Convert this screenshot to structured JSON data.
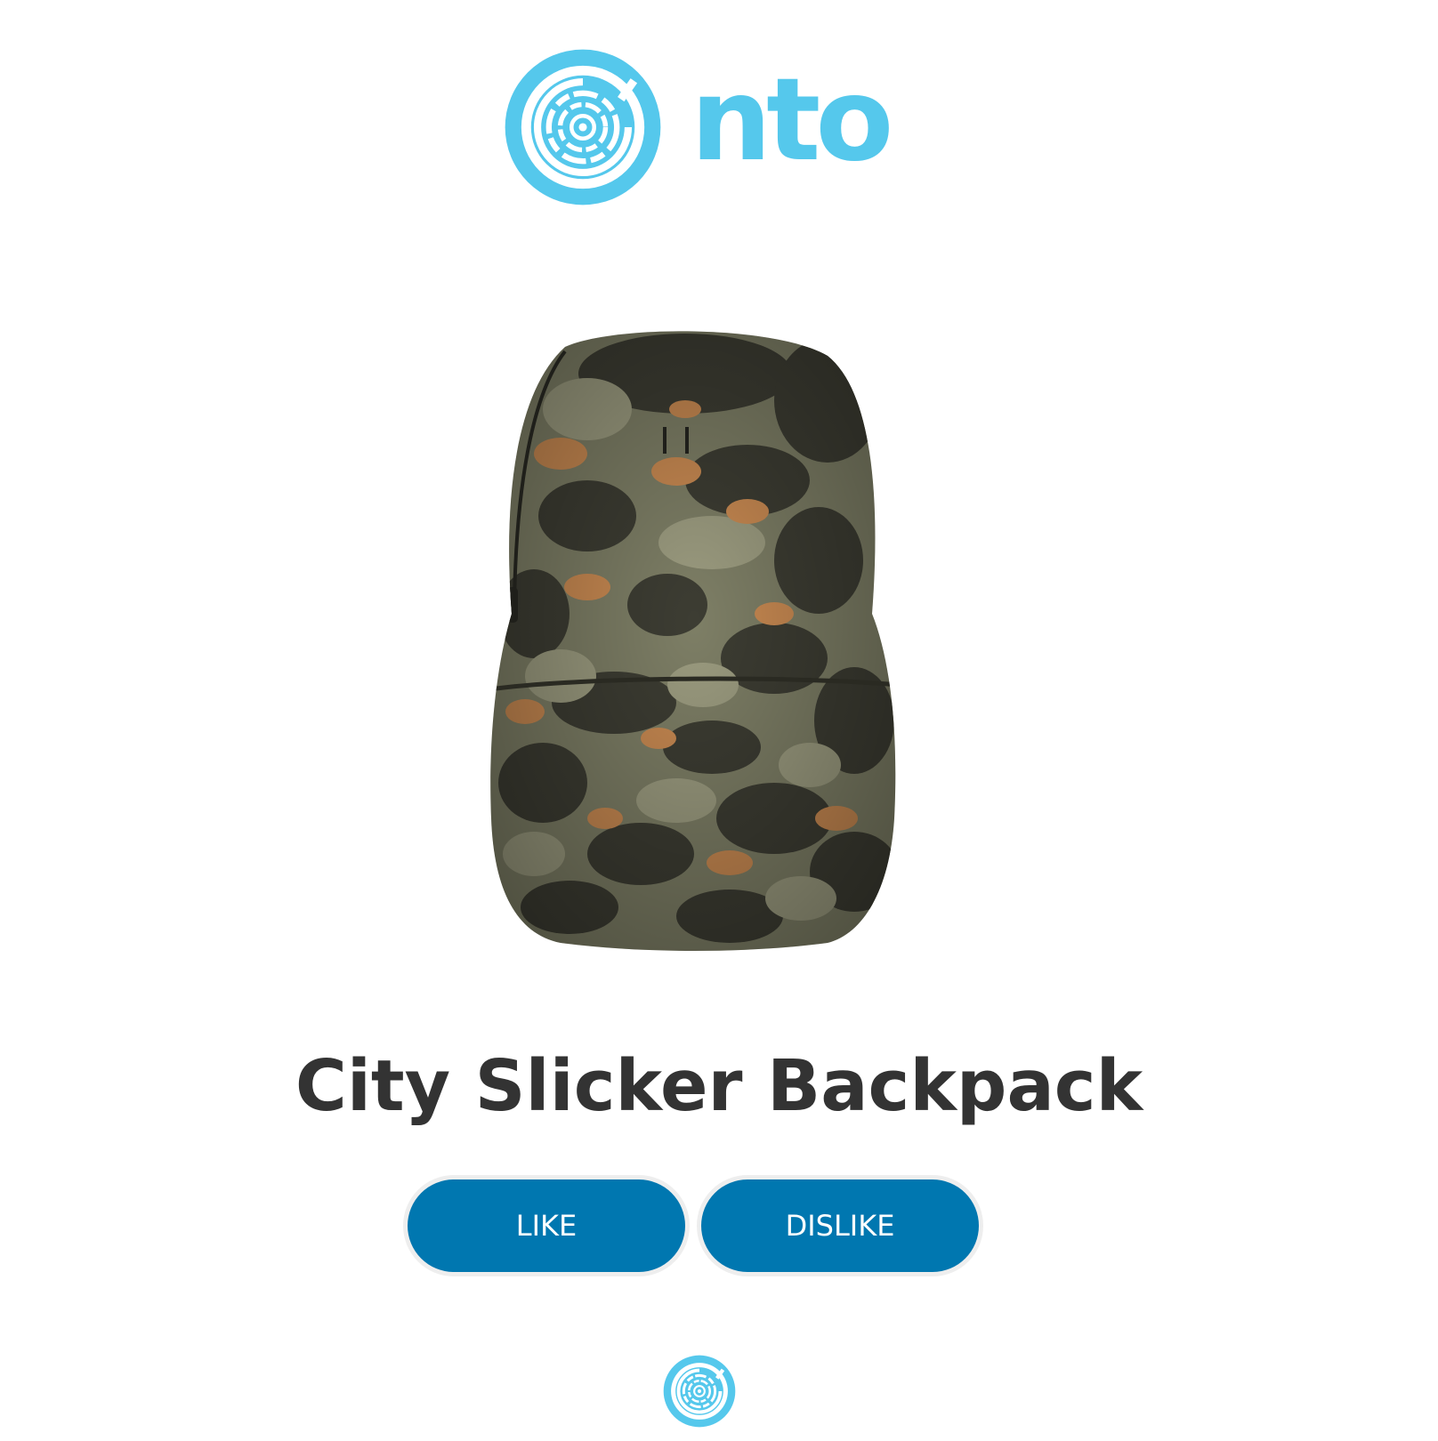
{
  "brand": {
    "name": "nto",
    "color": "#55c8ec"
  },
  "product": {
    "title": "City Slicker Backpack",
    "image_icon": "camo-backpack-image"
  },
  "actions": {
    "like_label": "LIKE",
    "dislike_label": "DISLIKE",
    "button_color": "#0077b0"
  },
  "footer": {
    "logo_icon": "nto-logo-icon"
  }
}
